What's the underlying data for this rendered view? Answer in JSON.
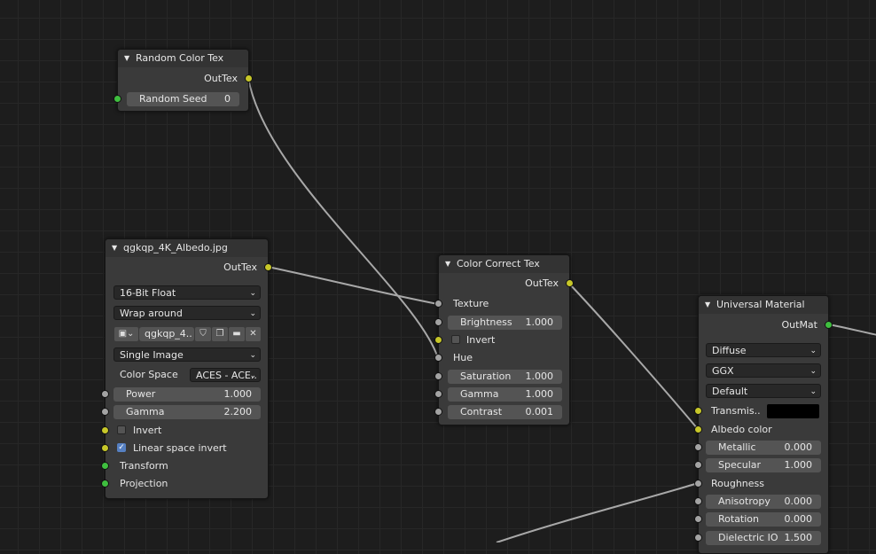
{
  "nodes": {
    "random_color": {
      "title": "Random Color Tex",
      "output": "OutTex",
      "seed_label": "Random Seed",
      "seed_value": "0"
    },
    "image": {
      "title": "qgkqp_4K_Albedo.jpg",
      "output": "OutTex",
      "bit_depth": "16-Bit Float",
      "wrap": "Wrap around",
      "image_name": "qgkqp_4..",
      "source": "Single Image",
      "color_space_label": "Color Space",
      "color_space_value": "ACES - ACE..",
      "power_label": "Power",
      "power_value": "1.000",
      "gamma_label": "Gamma",
      "gamma_value": "2.200",
      "invert_label": "Invert",
      "linear_invert_label": "Linear space invert",
      "transform_label": "Transform",
      "projection_label": "Projection"
    },
    "color_correct": {
      "title": "Color Correct Tex",
      "output": "OutTex",
      "texture_label": "Texture",
      "brightness_label": "Brightness",
      "brightness_value": "1.000",
      "invert_label": "Invert",
      "hue_label": "Hue",
      "saturation_label": "Saturation",
      "saturation_value": "1.000",
      "gamma_label": "Gamma",
      "gamma_value": "1.000",
      "contrast_label": "Contrast",
      "contrast_value": "0.001"
    },
    "universal_material": {
      "title": "Universal Material",
      "output": "OutMat",
      "brdf": "Diffuse",
      "distribution": "GGX",
      "layer": "Default",
      "transmission_label": "Transmis..",
      "albedo_label": "Albedo color",
      "metallic_label": "Metallic",
      "metallic_value": "0.000",
      "specular_label": "Specular",
      "specular_value": "1.000",
      "roughness_label": "Roughness",
      "anisotropy_label": "Anisotropy",
      "anisotropy_value": "0.000",
      "rotation_label": "Rotation",
      "rotation_value": "0.000",
      "dielectric_label": "Dielectric IO",
      "dielectric_value": "1.500"
    }
  },
  "colors": {
    "wire": "#a8a8a8",
    "socket_color": "#c7c729",
    "socket_vector": "#3fbf3f",
    "socket_float": "#a3a3a3",
    "node_bg": "#3a3a3a",
    "checkbox_on": "#5680c2"
  },
  "icons": {
    "collapse": "triangle-down-icon",
    "image_type": "image-icon",
    "shield": "shield-icon",
    "duplicate": "duplicate-icon",
    "folder": "folder-icon",
    "close": "close-icon"
  }
}
